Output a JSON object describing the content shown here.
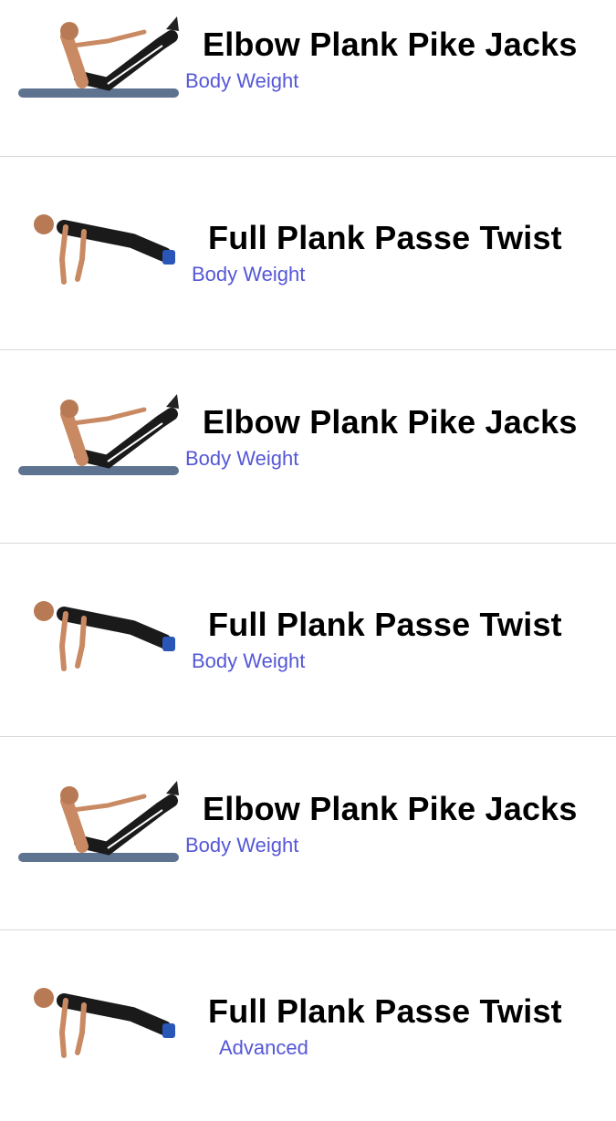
{
  "exercises": [
    {
      "title": "Elbow Plank Pike Jacks",
      "category": "Body Weight",
      "pose": "pike"
    },
    {
      "title": "Full Plank Passe Twist",
      "category": "Body Weight",
      "pose": "plank"
    },
    {
      "title": "Elbow Plank Pike Jacks",
      "category": "Body Weight",
      "pose": "pike"
    },
    {
      "title": "Full Plank Passe Twist",
      "category": "Body Weight",
      "pose": "plank"
    },
    {
      "title": "Elbow Plank Pike Jacks",
      "category": "Body Weight",
      "pose": "pike"
    },
    {
      "title": "Full Plank Passe Twist",
      "category": "Advanced",
      "pose": "plank"
    }
  ],
  "colors": {
    "title": "#000000",
    "subtitle": "#5557d6",
    "separator": "#d9d9d9",
    "mat": "#5d7390"
  },
  "icons": {
    "pike": "v-sit-exercise-icon",
    "plank": "push-up-plank-exercise-icon"
  }
}
